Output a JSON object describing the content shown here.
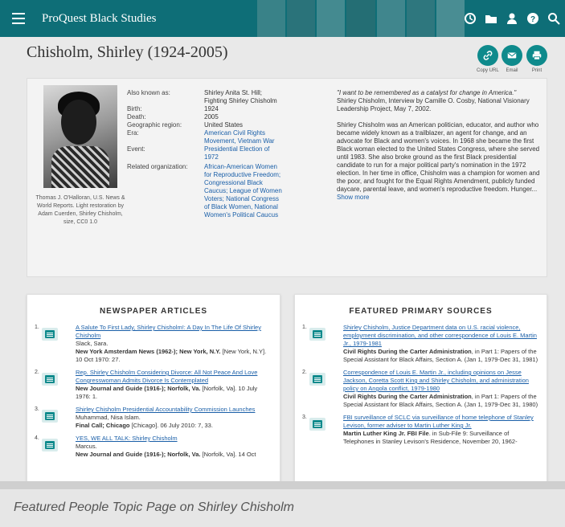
{
  "app": {
    "brand": "ProQuest Black Studies"
  },
  "page": {
    "title": "Chisholm, Shirley (1924-2005)"
  },
  "share": {
    "copy_url": "Copy URL",
    "email": "Email",
    "print": "Print"
  },
  "portrait": {
    "caption": "Thomas J. O'Halloran, U.S. News & World Reports. Light restoration by Adam Cuerden, Shirley Chisholm, size, CC0 1.0"
  },
  "facts": [
    {
      "label": "Also known as:",
      "value": "Shirley Anita St. Hill; Fighting Shirley Chisholm"
    },
    {
      "label": "Birth:",
      "value": "1924"
    },
    {
      "label": "Death:",
      "value": "2005"
    },
    {
      "label": "Geographic region:",
      "value": "United States"
    },
    {
      "label": "Era:",
      "value": "American Civil Rights Movement, Vietnam War"
    },
    {
      "label": "Event:",
      "value": "Presidential Election of 1972"
    },
    {
      "label": "Related organization:",
      "value": "African-American Women for Reproductive Freedom; Congressional Black Caucus; League of Women Voters; National Congress of Black Women, National Women's Political Caucus"
    }
  ],
  "bio": {
    "quote": "\"I want to be remembered as a catalyst for change in America.\"",
    "quote_source": "Shirley Chisholm, Interview by Camille O. Cosby, National Visionary Leadership Project, May 7, 2002.",
    "text": "Shirley Chisholm was an American politician, educator, and author who became widely known as a trailblazer, an agent for change, and an advocate for Black and women's voices. In 1968 she became the first Black woman elected to the United States Congress, where she served until 1983. She also broke ground as the first Black presidential candidate to run for a major political party's nomination in the 1972 election. In her time in office, Chisholm was a champion for women and the poor, and fought for the Equal Rights Amendment, publicly funded daycare, parental leave, and women's reproductive freedom. Hunger...",
    "show_more": "Show more"
  },
  "newspaper": {
    "title": "NEWSPAPER ARTICLES",
    "items": [
      {
        "num": "1.",
        "title": "A Salute To First Lady, Shirley Chisholm!: A Day In The Life Of Shirley Chisholm",
        "author": "Slack, Sara.",
        "source": "New York Amsterdam News (1962-); New York, N.Y.",
        "detail": " [New York, N.Y]. 10 Oct 1970: 27."
      },
      {
        "num": "2.",
        "title": "Rep. Shirley Chisholm Considering Divorce: All Not Peace And Love Congresswoman Admits Divorce Is Contemplated",
        "author": "",
        "source": "New Journal and Guide (1916-); Norfolk, Va.",
        "detail": " [Norfolk, Va]. 10 July 1976: 1."
      },
      {
        "num": "3.",
        "title": "Shirley Chisholm Presidential Accountability Commission Launches",
        "author": "Muhammad, Nisa Islam.",
        "source": "Final Call; Chicago",
        "detail": " [Chicago]. 06 July 2010: 7, 33."
      },
      {
        "num": "4.",
        "title": "YES, WE ALL TALK: Shirley Chisholm",
        "author": "Marcus.",
        "source": "New Journal and Guide (1916-); Norfolk, Va.",
        "detail": " [Norfolk, Va]. 14 Oct"
      }
    ]
  },
  "primary": {
    "title": "FEATURED PRIMARY SOURCES",
    "items": [
      {
        "num": "1.",
        "title": "Shirley Chisholm, Justice Department data on U.S. racial violence, employment discrimination, and other correspondence of Louis E. Martin Jr., 1979-1981",
        "source": "Civil Rights During the Carter Administration",
        "detail": ", in Part 1: Papers of the Special Assistant for Black Affairs, Section A. (Jan 1, 1979-Dec 31, 1981)"
      },
      {
        "num": "2.",
        "title": "Correspondence of Louis E. Martin Jr., including opinions on Jesse Jackson, Coretta Scott King and Shirley Chisholm, and administration policy on Angola conflict, 1979-1980",
        "source": "Civil Rights During the Carter Administration",
        "detail": ", in Part 1: Papers of the Special Assistant for Black Affairs, Section A. (Jan 1, 1979-Dec 31, 1980)"
      },
      {
        "num": "3.",
        "title": "FBI surveillance of SCLC via surveillance of home telephone of Stanley Levison, former adviser to Martin Luther King Jr.",
        "source": "Martin Luther King Jr. FBI File",
        "detail": ". in Sub-File 9: Surveillance of Telephones in Stanley Levison's Residence, November 20, 1962-"
      }
    ]
  },
  "footer": {
    "caption": "Featured People Topic Page on Shirley Chisholm"
  }
}
